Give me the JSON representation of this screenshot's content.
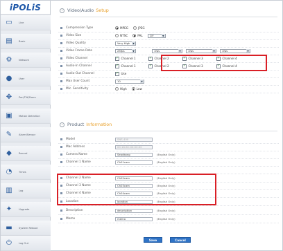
{
  "logo": "iPOLiS",
  "nav": [
    {
      "label": "Live",
      "icon": "monitor-icon"
    },
    {
      "label": "Basic",
      "icon": "settings-icon"
    },
    {
      "label": "Network",
      "icon": "network-icon"
    },
    {
      "label": "User",
      "icon": "user-icon"
    },
    {
      "label": "Pan/Tilt/Zoom",
      "icon": "ptz-icon"
    },
    {
      "label": "Motion Detection",
      "icon": "motion-icon"
    },
    {
      "label": "Alarm/Sensor",
      "icon": "alarm-icon"
    },
    {
      "label": "Record",
      "icon": "record-icon"
    },
    {
      "label": "Times",
      "icon": "clock-icon"
    },
    {
      "label": "Log",
      "icon": "log-icon"
    },
    {
      "label": "Upgrade",
      "icon": "upgrade-icon"
    },
    {
      "label": "System Reboot",
      "icon": "reboot-icon"
    },
    {
      "label": "Log Out",
      "icon": "logout-icon"
    }
  ],
  "video_setup": {
    "title_main": "Video/Audio",
    "title_accent": "Setup",
    "rows": {
      "compression": {
        "label": "Compression Type",
        "opt1": "MPEG",
        "opt2": "JPEG",
        "selected": "MPEG"
      },
      "video_size": {
        "label": "Video Size",
        "opt1": "NTSC",
        "opt2": "PAL",
        "selected": "PAL",
        "size": "CIF"
      },
      "video_quality": {
        "label": "Video Quality",
        "value": "Very High"
      },
      "frame_rate": {
        "label": "Video Frame Rate",
        "values": [
          "25fps",
          "1fps",
          "1fps",
          "1fps"
        ]
      },
      "video_channel": {
        "label": "Video Channel",
        "channels": [
          "Channel 1",
          "Channel 2",
          "Channel 3",
          "Channel 4"
        ]
      },
      "audio_in": {
        "label": "Audio-In Channel",
        "channels": [
          "Channel 1",
          "Channel 2",
          "Channel 3",
          "Channel 4"
        ]
      },
      "audio_out": {
        "label": "Audio-Out Channel",
        "value": "Use"
      },
      "max_users": {
        "label": "Max User Count",
        "value": "10"
      },
      "mic": {
        "label": "Mic. Sensitivity",
        "opt1": "High",
        "opt2": "Low",
        "selected": "Low"
      }
    }
  },
  "product_info": {
    "title_main": "Product",
    "title_accent": "Information",
    "rows": [
      {
        "label": "Model",
        "value": "SNS-400",
        "note": "",
        "disabled": true
      },
      {
        "label": "Mac Address",
        "value": "00:16:6C:00:00:00",
        "note": "",
        "disabled": true
      },
      {
        "label": "Camera Name",
        "value": "Seodkong",
        "note": "(English Only)",
        "disabled": false
      },
      {
        "label": "Channel 1 Name",
        "value": "Ch01cam",
        "note": "(English Only)",
        "disabled": false
      },
      {
        "label": "Channel 2 Name",
        "value": "Ch02cam",
        "note": "(English Only)",
        "disabled": false
      },
      {
        "label": "Channel 3 Name",
        "value": "Ch03cam",
        "note": "(English Only)",
        "disabled": false
      },
      {
        "label": "Channel 4 Name",
        "value": "Ch04cam",
        "note": "(English Only)",
        "disabled": false
      },
      {
        "label": "Location",
        "value": "location",
        "note": "(English Only)",
        "disabled": false
      },
      {
        "label": "Description",
        "value": "description",
        "note": "(English Only)",
        "disabled": false
      },
      {
        "label": "Memo",
        "value": "memo",
        "note": "(English Only)",
        "disabled": false
      }
    ]
  },
  "buttons": {
    "save": "Save",
    "cancel": "Cancel"
  },
  "colors": {
    "highlight_box": "#d91f26",
    "accent": "#e8a02a",
    "brand": "#1c56a8"
  }
}
